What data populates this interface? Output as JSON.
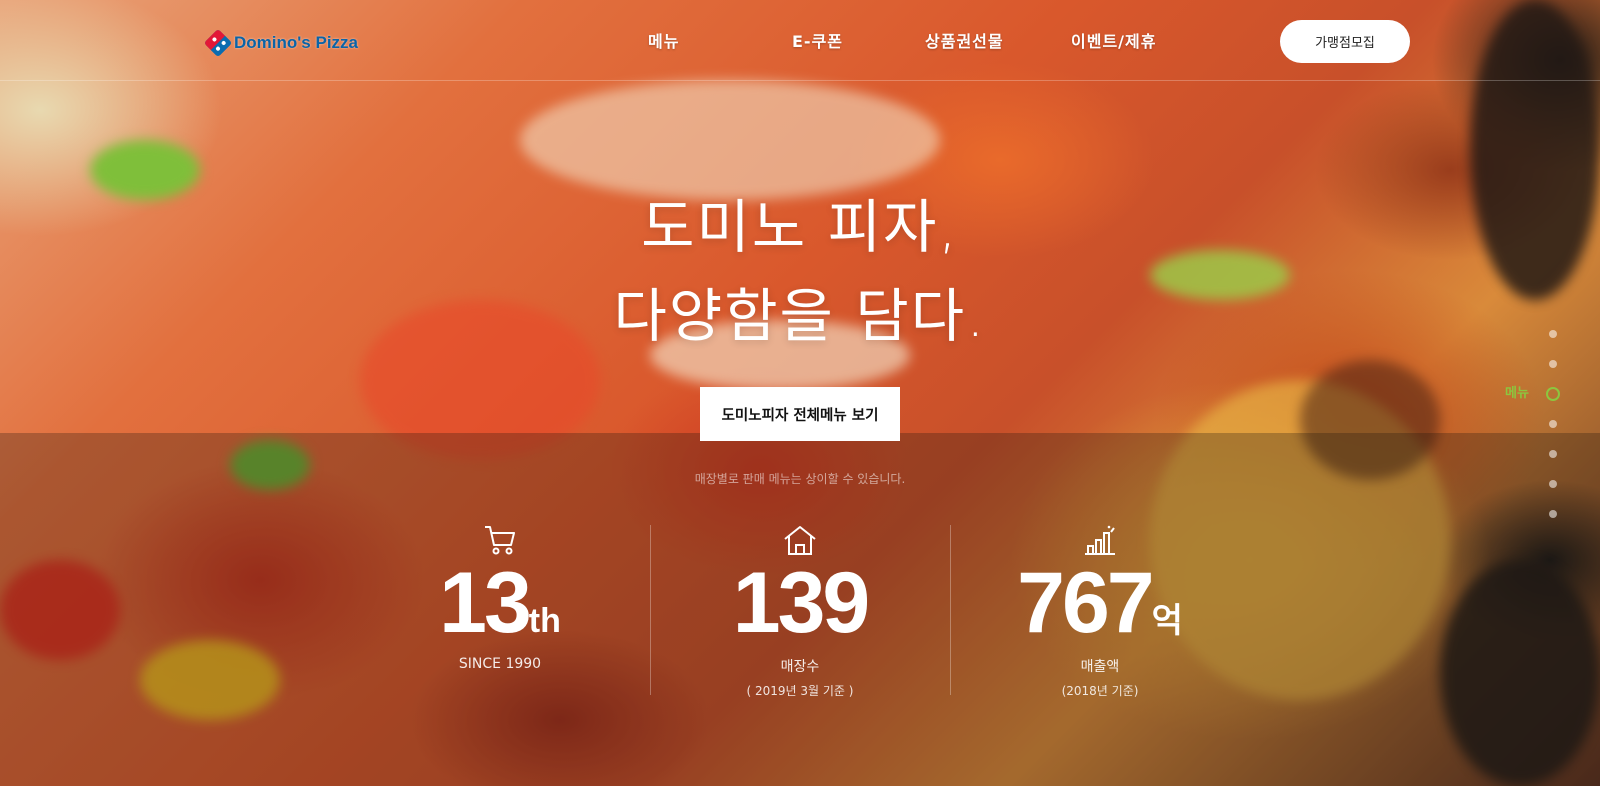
{
  "header": {
    "logo_text": "Domino's Pizza",
    "nav": [
      "메뉴",
      "E-쿠폰",
      "상품권선물",
      "이벤트/제휴"
    ],
    "franchise_button": "가맹점모집"
  },
  "hero": {
    "title_line1": "도미노 피자,",
    "title_line2": "다양함을 담다.",
    "cta_button": "도미노피자 전체메뉴 보기",
    "disclaimer": "매장별로 판매 메뉴는 상이할 수 있습니다."
  },
  "stats": [
    {
      "icon": "cart-icon",
      "number": "13",
      "unit": "th",
      "label": "SINCE 1990",
      "sub": ""
    },
    {
      "icon": "house-icon",
      "number": "139",
      "unit": "",
      "label": "매장수",
      "sub": "( 2019년 3월 기준 )"
    },
    {
      "icon": "bar-chart-icon",
      "number": "767",
      "unit": "억",
      "label": "매출액",
      "sub": "(2018년 기준)"
    }
  ],
  "side_nav": {
    "active_label": "메뉴",
    "active_color": "#8cc63f"
  }
}
